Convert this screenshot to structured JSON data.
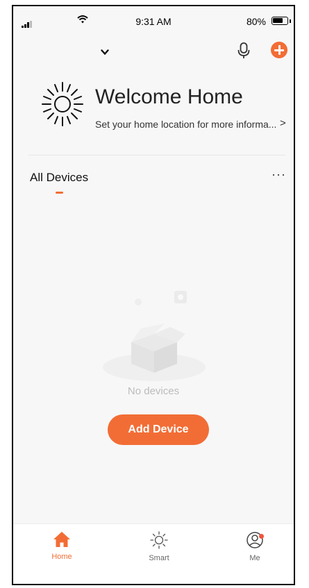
{
  "status_bar": {
    "time": "9:31 AM",
    "battery": "80%",
    "battery_level": 0.8
  },
  "header": {
    "home_name": "",
    "icons": [
      "chevron-down-icon",
      "mic-icon",
      "plus-icon"
    ]
  },
  "welcome": {
    "title": "Welcome Home",
    "subtitle": "Set your home location for more informa...",
    "arrow": ">"
  },
  "devices": {
    "title": "All Devices",
    "more": "···",
    "empty_text": "No devices",
    "add_button": "Add Device"
  },
  "tabs": [
    {
      "label": "Home",
      "icon": "home-icon",
      "active": true
    },
    {
      "label": "Smart",
      "icon": "sun-icon",
      "active": false
    },
    {
      "label": "Me",
      "icon": "profile-icon",
      "active": false
    }
  ],
  "colors": {
    "accent": "#f26d35",
    "badge": "#f0553b"
  }
}
